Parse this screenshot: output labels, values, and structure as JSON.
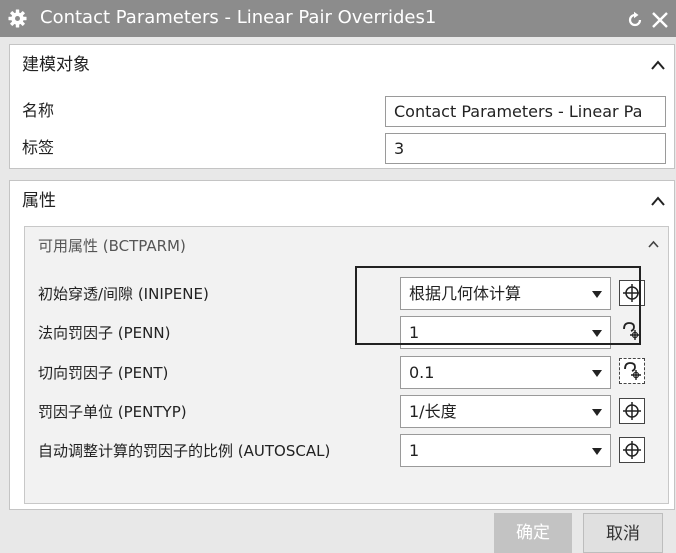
{
  "window": {
    "title": "Contact Parameters - Linear Pair Overrides1"
  },
  "modeling_group": {
    "header": "建模对象",
    "name_label": "名称",
    "name_value": "Contact Parameters - Linear Pa",
    "tag_label": "标签",
    "tag_value": "3"
  },
  "properties_group": {
    "header": "属性",
    "available_label": "可用属性 (BCTPARM)",
    "rows": [
      {
        "label": "初始穿透/间隙 (INIPENE)",
        "value": "根据几何体计算",
        "icon": "crosshair-icon"
      },
      {
        "label": "法向罚因子 (PENN)",
        "value": "1",
        "icon": "formula-icon"
      },
      {
        "label": "切向罚因子 (PENT)",
        "value": "0.1",
        "icon": "formula-icon"
      },
      {
        "label": "罚因子单位 (PENTYP)",
        "value": "1/长度",
        "icon": "crosshair-icon"
      },
      {
        "label": "自动调整计算的罚因子的比例 (AUTOSCAL)",
        "value": "1",
        "icon": "crosshair-icon"
      }
    ]
  },
  "footer": {
    "ok_label": "确定",
    "cancel_label": "取消"
  }
}
